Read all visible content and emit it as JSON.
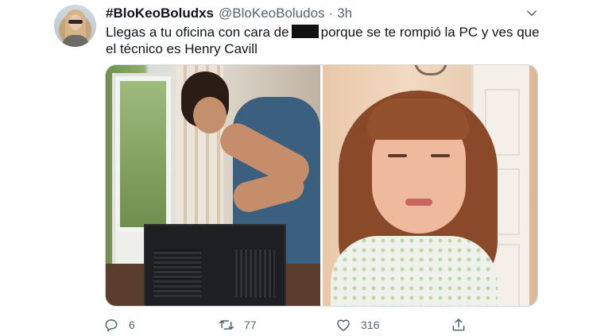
{
  "tweet": {
    "display_name": "#BloKeoBoludxs",
    "handle": "@BloKeoBoludos",
    "separator": "·",
    "time": "3h",
    "text_before_redaction": "Llegas a tu oficina con cara de",
    "text_after_redaction": "porque se te rompió la PC y ves que el técnico es Henry Cavill"
  },
  "icons": {
    "more": "chevron-down-icon",
    "reply": "reply-icon",
    "retweet": "retweet-icon",
    "like": "heart-icon",
    "share": "share-icon"
  },
  "actions": {
    "reply_count": "6",
    "retweet_count": "77",
    "like_count": "316"
  },
  "colors": {
    "text": "#0f1419",
    "muted": "#536471",
    "border": "#cfd9de"
  }
}
